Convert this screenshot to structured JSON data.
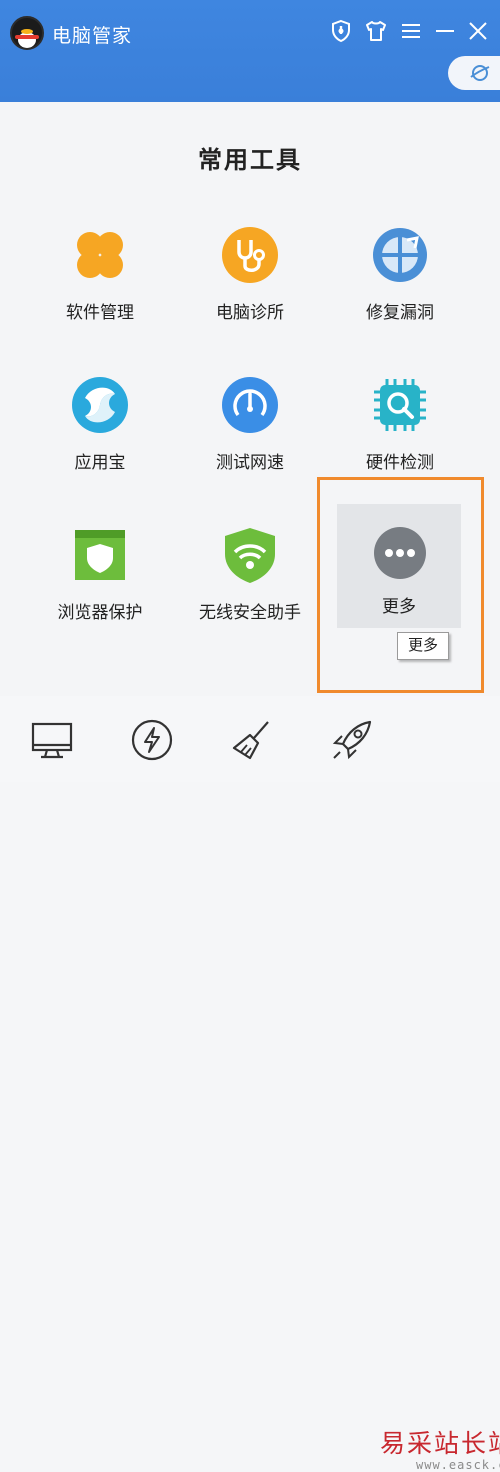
{
  "app": {
    "title": "电脑管家"
  },
  "window_icons": [
    "shield-icon",
    "shirt-icon",
    "menu-icon",
    "minimize-icon",
    "close-icon"
  ],
  "skin_button": {
    "icon": "planet-icon"
  },
  "section": {
    "title": "常用工具"
  },
  "tools": [
    {
      "label": "软件管理",
      "icon": "clover-icon",
      "color": "#f6a623"
    },
    {
      "label": "电脑诊所",
      "icon": "stethoscope-icon",
      "color": "#f6a623"
    },
    {
      "label": "修复漏洞",
      "icon": "repair-globe-icon",
      "color": "#4a8fd6"
    },
    {
      "label": "应用宝",
      "icon": "appstore-icon",
      "color": "#2aa9dd"
    },
    {
      "label": "测试网速",
      "icon": "speed-gauge-icon",
      "color": "#3a8ee6"
    },
    {
      "label": "硬件检测",
      "icon": "chip-search-icon",
      "color": "#28b3c8"
    },
    {
      "label": "浏览器保护",
      "icon": "browser-shield-icon",
      "color": "#6dbd3c"
    },
    {
      "label": "无线安全助手",
      "icon": "wifi-shield-icon",
      "color": "#6dbd3c"
    },
    {
      "label": "更多",
      "icon": "more-dots-icon",
      "color": "#777c82"
    }
  ],
  "tooltip": {
    "text": "更多"
  },
  "bottom_nav": [
    "monitor-icon",
    "lightning-icon",
    "broom-icon",
    "rocket-icon"
  ],
  "watermark": {
    "text": "易采站长站",
    "url": "www.easck.com"
  },
  "colors": {
    "titlebar": "#3a7fd9",
    "highlight_border": "#f08a2d",
    "panel_bg": "#f4f5f7"
  }
}
